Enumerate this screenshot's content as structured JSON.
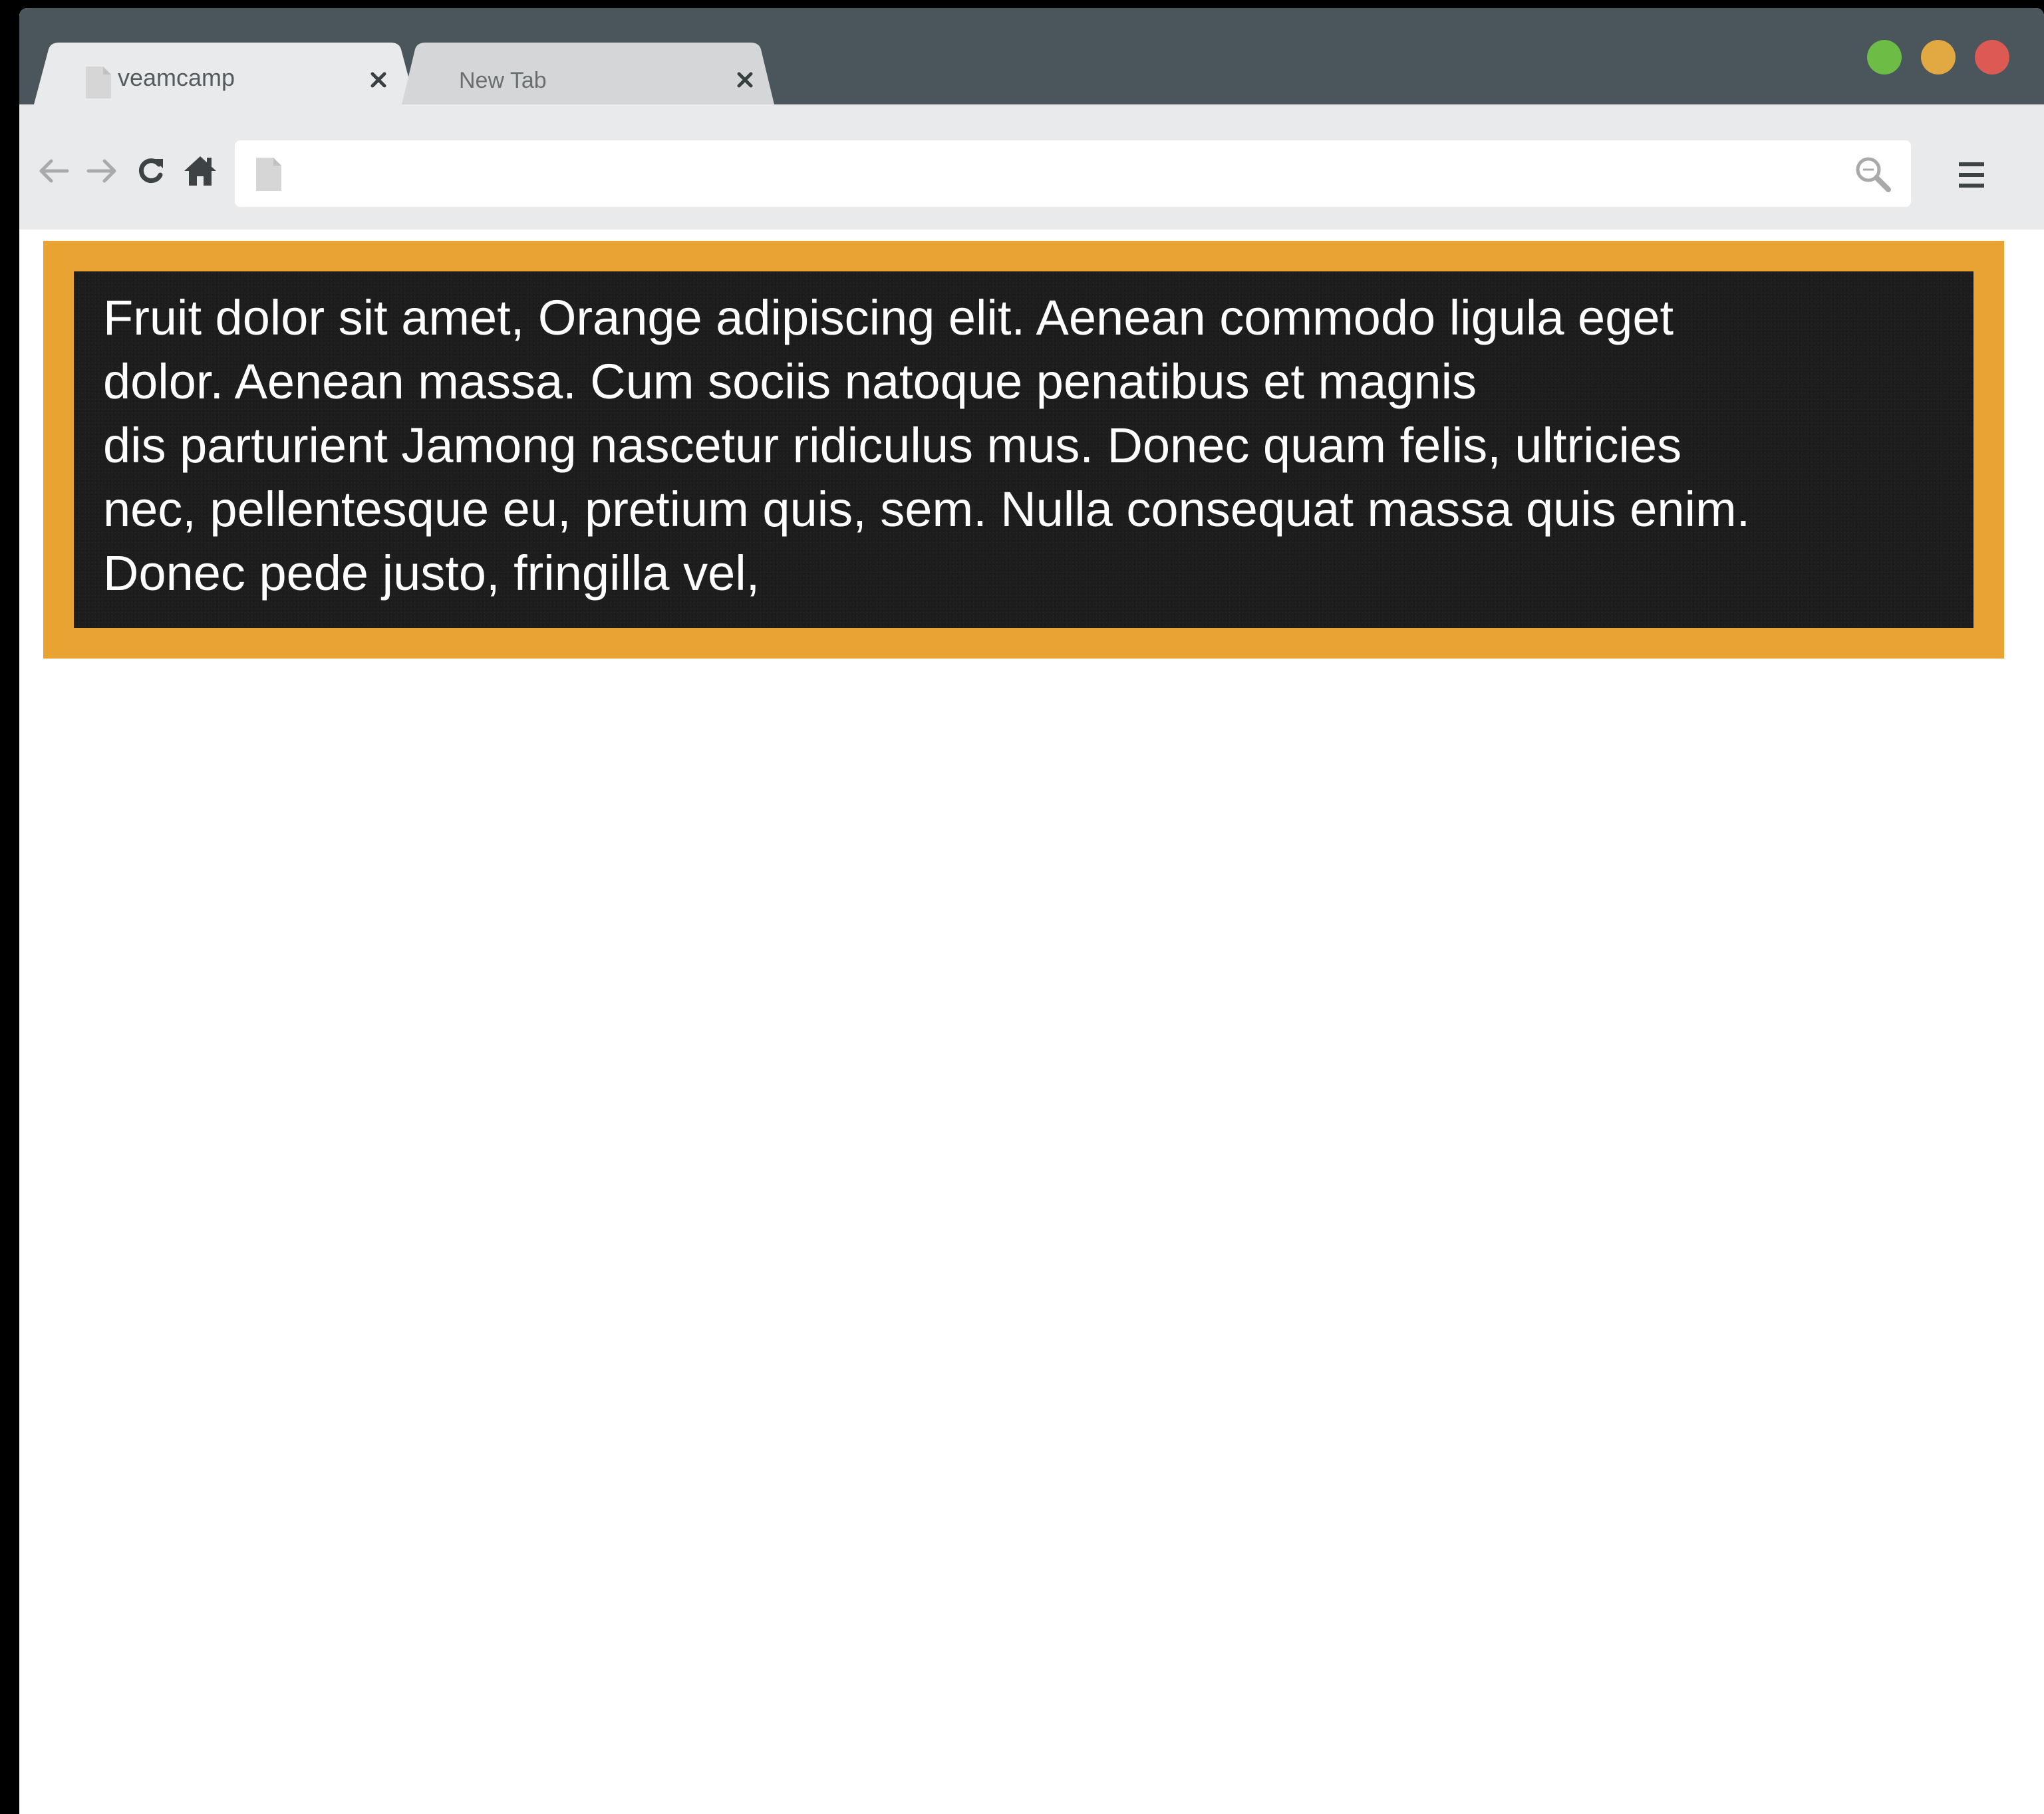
{
  "browser": {
    "tabs": [
      {
        "title": "veamcamp",
        "active": true
      },
      {
        "title": "New Tab",
        "active": false
      }
    ],
    "window_controls": {
      "green": "#6cbc45",
      "yellow": "#e2a842",
      "red": "#dd5a54"
    },
    "address_bar": {
      "value": "",
      "placeholder": ""
    }
  },
  "page": {
    "frame_color": "#e8a333",
    "box_color": "#1d1d1d",
    "text_lines": [
      "Fruit dolor sit amet, Orange adipiscing elit. Aenean commodo ligula eget",
      "dolor. Aenean massa. Cum sociis natoque penatibus et magnis",
      "dis parturient Jamong nascetur ridiculus mus. Donec quam felis, ultricies",
      "nec, pellentesque eu, pretium quis, sem. Nulla consequat massa quis enim.",
      "Donec pede justo, fringilla vel,"
    ]
  }
}
